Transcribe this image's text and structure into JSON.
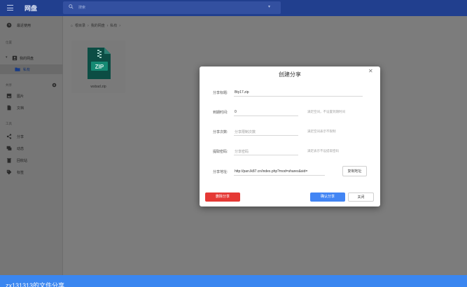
{
  "app": {
    "title": "网盘"
  },
  "search": {
    "placeholder": "搜索"
  },
  "sidebar": {
    "recent": "最近使用",
    "section_location": "位置",
    "my_drive": "我的网盘",
    "my_drive_child": "私有",
    "section_shared": "共享",
    "shared_items": [
      "图片",
      "文档"
    ],
    "section_tools": "工具",
    "tools": [
      "分享",
      "动态",
      "回收站",
      "标签"
    ]
  },
  "breadcrumb": [
    "根目录",
    "我的网盘",
    "私有"
  ],
  "file": {
    "name": "wsbad.zip",
    "badge": "ZIP"
  },
  "dialog": {
    "title": "创建分享",
    "share_title_label": "分享标题:",
    "share_title_value": "Bty17.zip",
    "expire_label": "到期时间:",
    "expire_value": "0",
    "expire_hint": "满足空间，不设置到期时间",
    "count_label": "分享次数:",
    "count_placeholder": "分享限制次数",
    "count_hint": "满足空间表示不限制",
    "password_label": "提取密码:",
    "password_placeholder": "分享密码",
    "password_hint": "满足表示不设提取密码",
    "url_label": "分享地址:",
    "url_value": "http://pan.lk87.cn/index.php?mod=shares&sid=",
    "copy_button": "复制地址",
    "delete_button": "删除分享",
    "confirm_button": "确认分享",
    "close_button": "关闭"
  },
  "footer": {
    "text": "zx131313的文件分享"
  },
  "colors": {
    "topbar": "#213f8e",
    "accent": "#4285f4",
    "danger": "#e53935",
    "footer": "#3a86f0"
  }
}
